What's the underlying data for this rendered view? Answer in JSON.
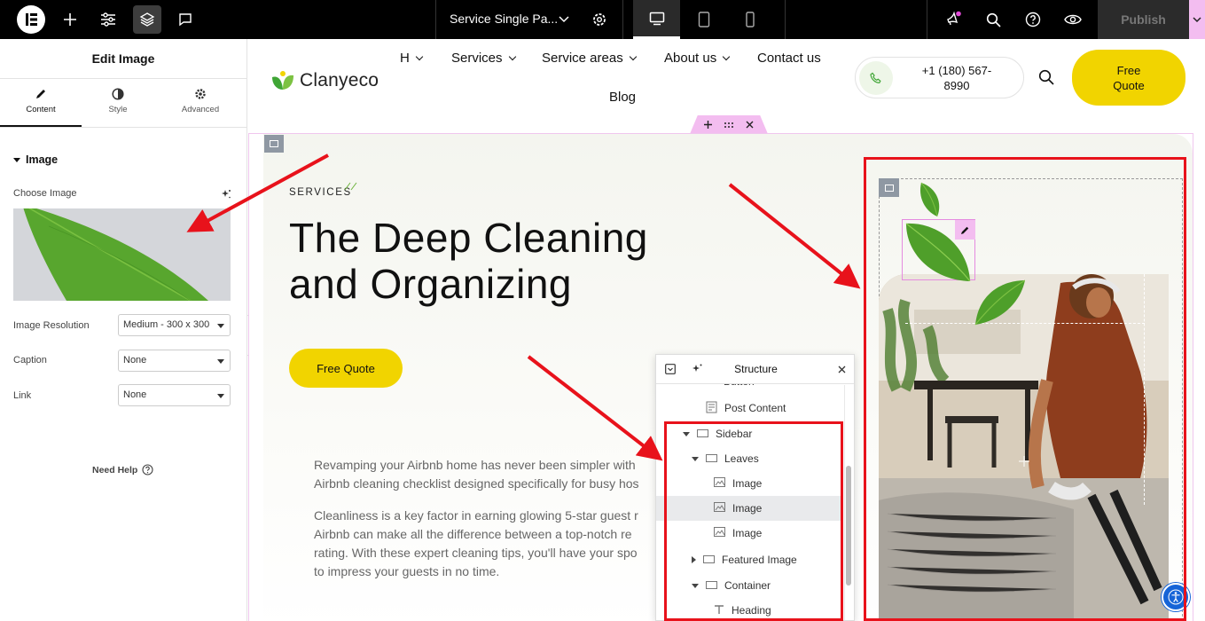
{
  "topbar": {
    "page_title": "Service Single Pa...",
    "publish_label": "Publish",
    "icons": [
      "elementor-logo-icon",
      "plus-icon",
      "sliders-icon",
      "layers-icon",
      "comment-icon",
      "gear-icon",
      "desktop-icon",
      "tablet-icon",
      "mobile-icon",
      "whats-new-icon",
      "search-icon",
      "help-icon",
      "eye-icon",
      "chevron-down-icon"
    ]
  },
  "panel": {
    "title": "Edit Image",
    "tabs": [
      {
        "label": "Content",
        "icon": "pencil-icon"
      },
      {
        "label": "Style",
        "icon": "half-circle-icon"
      },
      {
        "label": "Advanced",
        "icon": "gear-icon"
      }
    ],
    "section_title": "Image",
    "choose_image_label": "Choose Image",
    "fields": [
      {
        "label": "Image Resolution",
        "value": "Medium - 300 x 300"
      },
      {
        "label": "Caption",
        "value": "None"
      },
      {
        "label": "Link",
        "value": "None"
      }
    ],
    "need_help": "Need Help"
  },
  "site": {
    "logo_text": "Clanyeco",
    "nav": [
      "H",
      "Services",
      "Service areas",
      "About us",
      "Contact us",
      "Blog"
    ],
    "phone": "+1 (180) 567-8990",
    "quote_btn": "Free Quote",
    "accent": "#f1d400",
    "brand_green": "#3fa535"
  },
  "hero": {
    "eyebrow": "SERVICES",
    "heading_line1": "The Deep Cleaning",
    "heading_line2": "and Organizing",
    "cta": "Free Quote",
    "para1_line1": "Revamping your Airbnb home has never been simpler with",
    "para1_line2": "Airbnb cleaning checklist designed specifically for busy hos",
    "para2_line1": "Cleanliness is a key factor in earning glowing 5-star guest r",
    "para2_line2": "Airbnb can make all the difference between a top-notch re",
    "para2_line3": "rating. With these expert cleaning tips, you'll have your spo",
    "para2_line4": "to impress your guests in no time."
  },
  "structure": {
    "title": "Structure",
    "items": [
      {
        "label": "Button",
        "icon": "button-icon"
      },
      {
        "label": "Post Content",
        "icon": "post-content-icon"
      },
      {
        "label": "Sidebar",
        "icon": "container-icon"
      },
      {
        "label": "Leaves",
        "icon": "container-icon"
      },
      {
        "label": "Image",
        "icon": "image-icon"
      },
      {
        "label": "Image",
        "icon": "image-icon"
      },
      {
        "label": "Image",
        "icon": "image-icon"
      },
      {
        "label": "Featured Image",
        "icon": "container-icon"
      },
      {
        "label": "Container",
        "icon": "container-icon"
      },
      {
        "label": "Heading",
        "icon": "heading-icon"
      }
    ]
  }
}
